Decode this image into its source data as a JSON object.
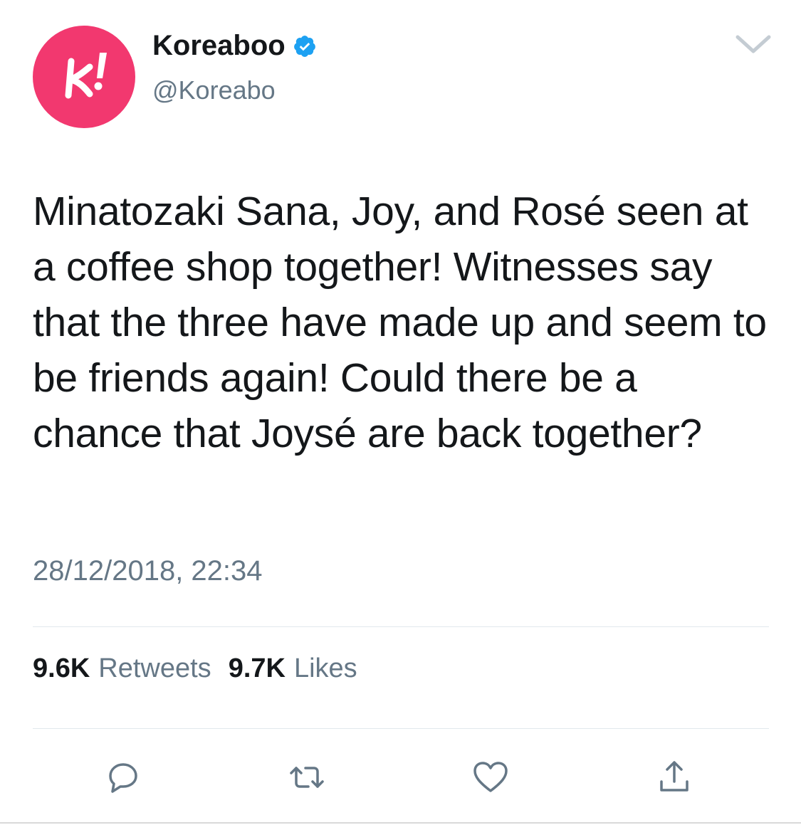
{
  "author": {
    "name": "Koreaboo",
    "handle": "@Koreabo",
    "verified": true,
    "avatar_color": "#f2386f",
    "avatar_icon": "koreaboo-logo-icon"
  },
  "tweet": {
    "text": "Minatozaki Sana, Joy, and Rosé seen at a coffee shop together! Witnesses say that the three have made up and seem to be friends again! Could there be a chance that Joysé are back together?",
    "timestamp": "28/12/2018, 22:34"
  },
  "stats": {
    "retweets_count": "9.6K",
    "retweets_label": "Retweets",
    "likes_count": "9.7K",
    "likes_label": "Likes"
  },
  "actions": [
    {
      "name": "reply",
      "icon": "reply-icon"
    },
    {
      "name": "retweet",
      "icon": "retweet-icon"
    },
    {
      "name": "like",
      "icon": "heart-icon"
    },
    {
      "name": "share",
      "icon": "share-icon"
    }
  ],
  "colors": {
    "text_primary": "#14171a",
    "text_secondary": "#657786",
    "verified_blue": "#1da1f2",
    "divider": "#e1e8ed"
  }
}
